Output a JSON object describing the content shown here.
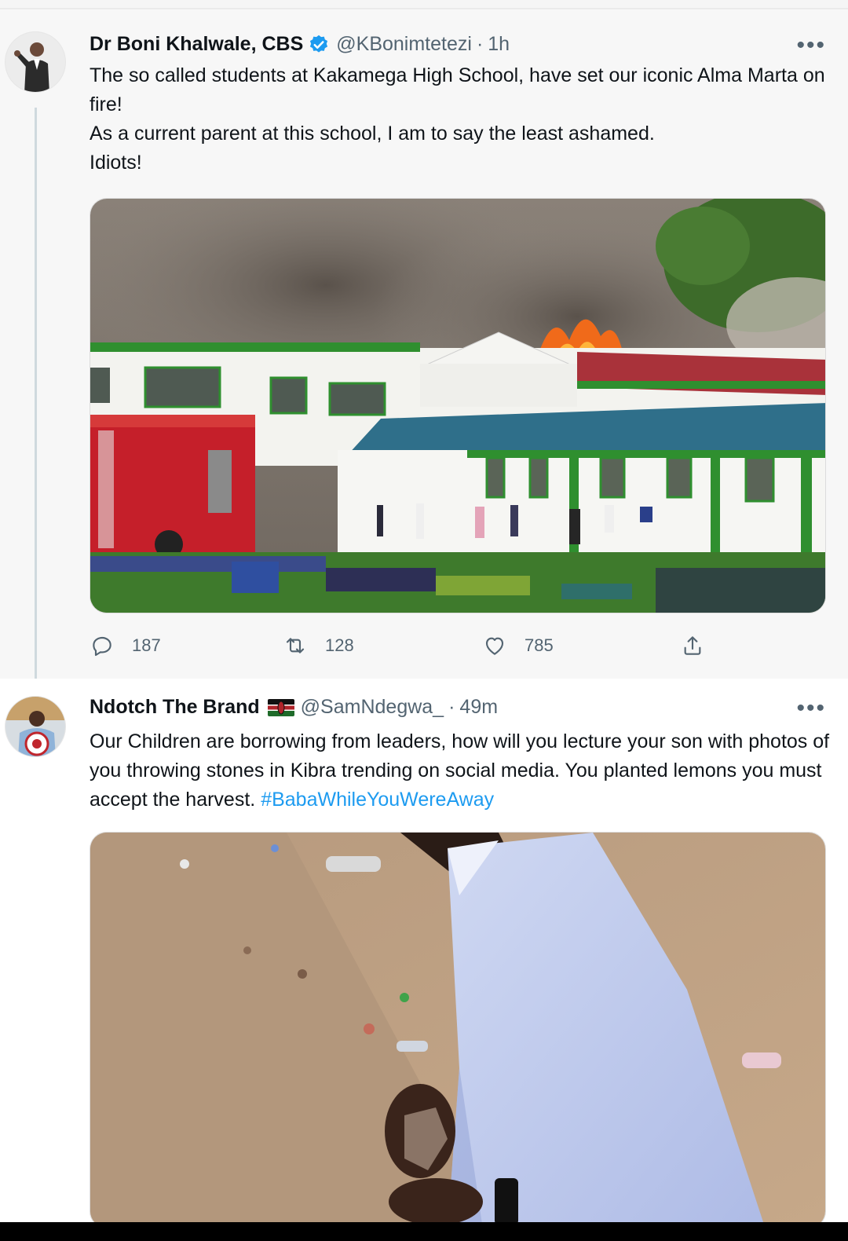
{
  "tweets": [
    {
      "author": {
        "name": "Dr Boni Khalwale, CBS",
        "handle": "@KBonimtetezi",
        "verified": true
      },
      "time": "1h",
      "separator": "·",
      "more_label": "•••",
      "text_lines": [
        "The so called students at Kakamega High School, have set our iconic Alma Marta on fire!",
        "As a current parent at this school, I am to say the least ashamed.",
        "Idiots!"
      ],
      "media_description_icon": "photo",
      "stats": {
        "replies": "187",
        "retweets": "128",
        "likes": "785"
      }
    },
    {
      "author": {
        "name": "Ndotch The Brand",
        "handle": "@SamNdegwa_",
        "flag": "kenya-flag-icon"
      },
      "time": "49m",
      "separator": "·",
      "more_label": "•••",
      "text": "Our Children are borrowing from leaders, how will you lecture your son with photos of you throwing stones in Kibra trending on social media. You planted lemons you must accept the harvest. ",
      "hashtag": "#BabaWhileYouWereAway"
    }
  ],
  "colors": {
    "link": "#1d9bf0",
    "secondary_text": "#536471",
    "verified": "#1d9bf0"
  }
}
